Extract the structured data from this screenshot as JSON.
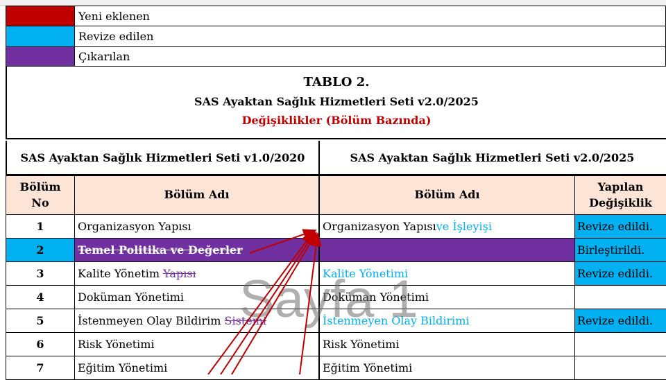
{
  "legend": [
    {
      "label": "Yeni eklenen",
      "color": "#c00000"
    },
    {
      "label": "Revize edilen",
      "color": "#00b0f0"
    },
    {
      "label": "Çıkarılan",
      "color": "#7030a0"
    }
  ],
  "title": {
    "line1": "TABLO 2.",
    "line2": "SAS Ayaktan Sağlık Hizmetleri Seti v2.0/2025",
    "line3": "Değişiklikler (Bölüm Bazında)"
  },
  "versions": {
    "old": "SAS Ayaktan Sağlık Hizmetleri Seti v1.0/2020",
    "new": "SAS Ayaktan Sağlık Hizmetleri Seti v2.0/2025"
  },
  "headers": {
    "no": "Bölüm No",
    "old_name": "Bölüm Adı",
    "new_name": "Bölüm Adı",
    "change": "Yapılan Değişiklik"
  },
  "rows": [
    {
      "no": "1",
      "old": "Organizasyon Yapısı",
      "old_strike": "",
      "new": "Organizasyon Yapısı",
      "new_added": " ve İşleyişi",
      "change": "Revize edildi."
    },
    {
      "no": "2",
      "old": "",
      "old_strike": "Temel Politika ve Değerler",
      "new": "",
      "new_added": "",
      "change": "Birleştirildi."
    },
    {
      "no": "3",
      "old": "Kalite Yönetim ",
      "old_strike": "Yapısı",
      "new": "",
      "new_added": "Kalite Yönetimi",
      "change": "Revize edildi."
    },
    {
      "no": "4",
      "old": "Doküman Yönetimi",
      "old_strike": "",
      "new": "Doküman Yönetimi",
      "new_added": "",
      "change": ""
    },
    {
      "no": "5",
      "old": "İstenmeyen Olay Bildirim ",
      "old_strike": "Sistemi",
      "new": "",
      "new_added": "İstenmeyen Olay Bildirimi",
      "change": "Revize edildi."
    },
    {
      "no": "6",
      "old": "Risk Yönetimi",
      "old_strike": "",
      "new": "Risk Yönetimi",
      "new_added": "",
      "change": ""
    },
    {
      "no": "7",
      "old": "Eğitim Yönetimi",
      "old_strike": "",
      "new": "Eğitim Yönetimi",
      "new_added": "",
      "change": ""
    }
  ],
  "watermark": "Sayfa 1"
}
